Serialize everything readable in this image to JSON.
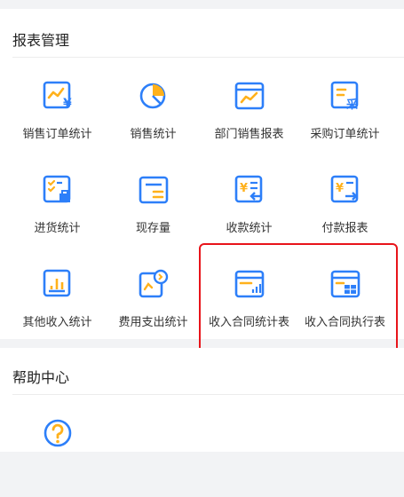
{
  "report_section": {
    "title": "报表管理",
    "items": [
      {
        "label": "销售订单统计",
        "icon": "sales-order-stats-icon"
      },
      {
        "label": "销售统计",
        "icon": "pie-chart-icon"
      },
      {
        "label": "部门销售报表",
        "icon": "department-report-icon"
      },
      {
        "label": "采购订单统计",
        "icon": "purchase-order-icon"
      },
      {
        "label": "进货统计",
        "icon": "stock-in-icon"
      },
      {
        "label": "现存量",
        "icon": "inventory-icon"
      },
      {
        "label": "收款统计",
        "icon": "receipt-icon"
      },
      {
        "label": "付款报表",
        "icon": "payment-icon"
      },
      {
        "label": "其他收入统计",
        "icon": "bar-chart-icon"
      },
      {
        "label": "费用支出统计",
        "icon": "expense-icon"
      },
      {
        "label": "收入合同统计表",
        "icon": "contract-stats-icon"
      },
      {
        "label": "收入合同执行表",
        "icon": "contract-execution-icon"
      }
    ]
  },
  "help_section": {
    "title": "帮助中心",
    "items": [
      {
        "label": "",
        "icon": "question-icon"
      }
    ]
  },
  "colors": {
    "blue": "#2d7ff9",
    "orange": "#ffb11b",
    "highlight": "#e8141a"
  }
}
